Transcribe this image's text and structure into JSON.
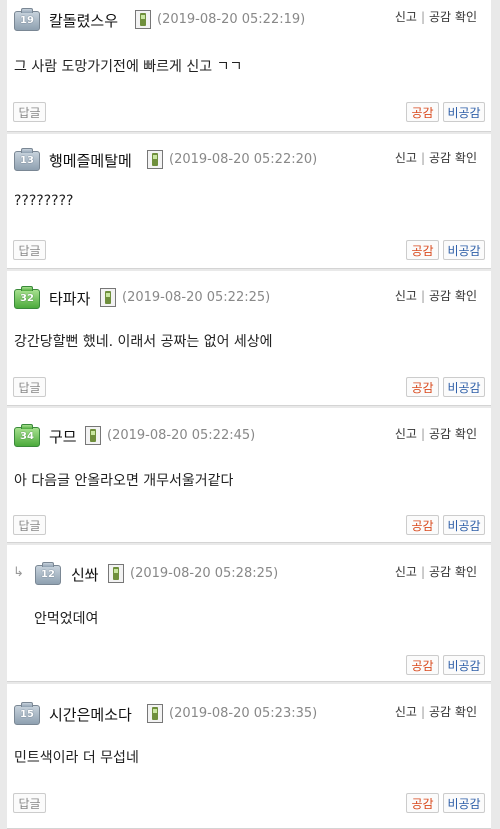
{
  "actions": {
    "report": "신고",
    "like_confirm": "공감 확인"
  },
  "buttons": {
    "reply": "답글",
    "like": "공감",
    "dislike": "비공감"
  },
  "comments": [
    {
      "level": "19",
      "level_color": "gray",
      "nick": "칼돌렸스우",
      "time": "(2019-08-20 05:22:19)",
      "text": "그 사람 도망가기전에 빠르게 신고 ㄱㄱ",
      "reply": false
    },
    {
      "level": "13",
      "level_color": "gray",
      "nick": "행메즐메탈메",
      "time": "(2019-08-20 05:22:20)",
      "text": "????????",
      "reply": false
    },
    {
      "level": "32",
      "level_color": "green",
      "nick": "타파자",
      "time": "(2019-08-20 05:22:25)",
      "text": "강간당할뻔 했네. 이래서 공짜는 없어 세상에",
      "reply": false
    },
    {
      "level": "34",
      "level_color": "green",
      "nick": "구므",
      "time": "(2019-08-20 05:22:45)",
      "text": "아 다음글 안올라오면 개무서울거같다",
      "reply": false
    },
    {
      "level": "12",
      "level_color": "gray",
      "nick": "신쏴",
      "time": "(2019-08-20 05:28:25)",
      "text": "안먹었데여",
      "reply": true
    },
    {
      "level": "15",
      "level_color": "gray",
      "nick": "시간은메소다",
      "time": "(2019-08-20 05:23:35)",
      "text": "민트색이라 더 무섭네",
      "reply": false
    }
  ]
}
